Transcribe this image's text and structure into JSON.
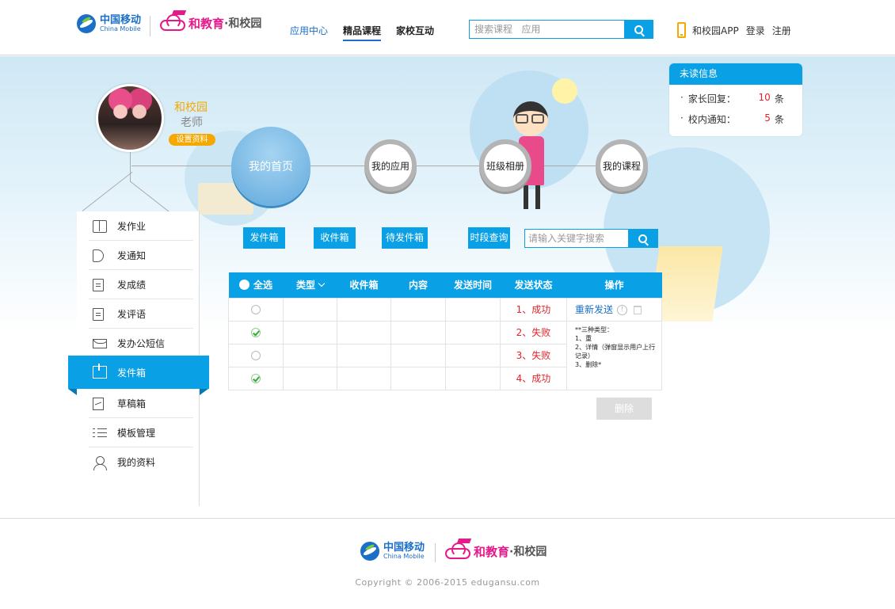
{
  "brand": {
    "cm_cn": "中国移动",
    "cm_en": "China Mobile",
    "he_brand": "和教育",
    "he_sub": "·和校园"
  },
  "nav": {
    "items": [
      {
        "label": "应用中心"
      },
      {
        "label": "精品课程"
      },
      {
        "label": "家校互动"
      }
    ]
  },
  "search": {
    "placeholder": "搜索课程   应用"
  },
  "header_right": {
    "app": "和校园APP",
    "login": "登录",
    "register": "注册"
  },
  "unread": {
    "title": "未读信息",
    "rows": [
      {
        "label": "家长回复：",
        "count": "10",
        "unit": "条"
      },
      {
        "label": "校内通知：",
        "count": "5",
        "unit": "条"
      }
    ]
  },
  "profile": {
    "name": "和校园",
    "role": "老师",
    "settings": "设置资料"
  },
  "circles": {
    "home": "我的首页",
    "apps": "我的应用",
    "album": "班级相册",
    "courses": "我的课程"
  },
  "sidebar": {
    "items": [
      {
        "label": "发作业",
        "icon": "book-icon"
      },
      {
        "label": "发通知",
        "icon": "megaphone-icon"
      },
      {
        "label": "发成绩",
        "icon": "grade-doc-icon"
      },
      {
        "label": "发评语",
        "icon": "comment-doc-icon"
      },
      {
        "label": "发办公短信",
        "icon": "mail-icon"
      },
      {
        "label": "发件箱",
        "icon": "outbox-icon"
      },
      {
        "label": "草稿箱",
        "icon": "draft-icon"
      },
      {
        "label": "模板管理",
        "icon": "list-icon"
      },
      {
        "label": "我的资料",
        "icon": "user-icon"
      }
    ]
  },
  "toolbar": {
    "outbox": "发件箱",
    "inbox": "收件箱",
    "pending": "待发件箱",
    "period": "时段查询",
    "keyword_placeholder": "请输入关键字搜索"
  },
  "table": {
    "headers": {
      "select_all": "全选",
      "type": "类型",
      "inbox": "收件箱",
      "content": "内容",
      "send_time": "发送时间",
      "status": "发送状态",
      "action": "操作"
    },
    "rows": [
      {
        "checked": false,
        "status": "1、成功"
      },
      {
        "checked": true,
        "status": "2、失败"
      },
      {
        "checked": false,
        "status": "3、失败"
      },
      {
        "checked": true,
        "status": "4、成功"
      }
    ],
    "resend": "重新发送",
    "note": "**三种类型：\n1、重\n2、详情（弹窗显示用户上行记录）\n3、删除*"
  },
  "delete_button": "删除",
  "footer": {
    "copyright": "Copyright © 2006-2015   edugansu.com"
  },
  "colors": {
    "accent": "#0aa0e6",
    "brand_pink": "#e5198a",
    "brand_blue": "#1b6fc7",
    "status_red": "#e5222a",
    "profile_orange": "#f5a800"
  }
}
